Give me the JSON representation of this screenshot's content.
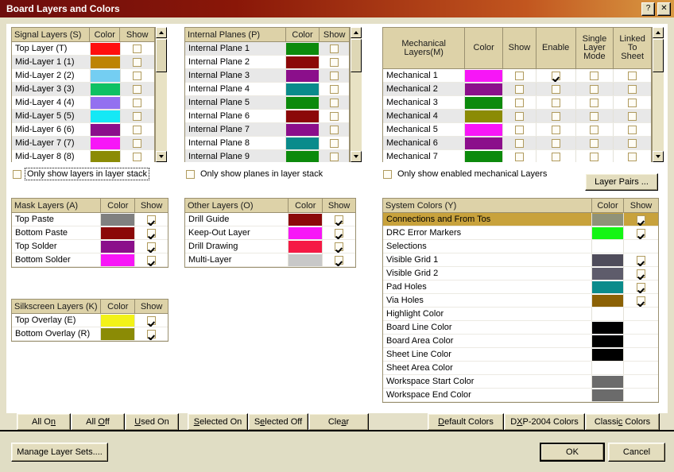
{
  "window": {
    "title": "Board Layers and Colors",
    "help_button": "?",
    "close_button": "✕"
  },
  "signal_layers": {
    "headers": [
      "Signal Layers (S)",
      "Color",
      "Show"
    ],
    "rows": [
      {
        "name": "Top Layer (T)",
        "color": "#ff0f0f",
        "show": false
      },
      {
        "name": "Mid-Layer 1 (1)",
        "color": "#bd8403",
        "show": false
      },
      {
        "name": "Mid-Layer 2 (2)",
        "color": "#74cef2",
        "show": false
      },
      {
        "name": "Mid-Layer 3 (3)",
        "color": "#0ec163",
        "show": false
      },
      {
        "name": "Mid-Layer 4 (4)",
        "color": "#9370f0",
        "show": false
      },
      {
        "name": "Mid-Layer 5 (5)",
        "color": "#15e8f5",
        "show": false
      },
      {
        "name": "Mid-Layer 6 (6)",
        "color": "#8b0f8b",
        "show": false
      },
      {
        "name": "Mid-Layer 7 (7)",
        "color": "#f716f7",
        "show": false
      },
      {
        "name": "Mid-Layer 8 (8)",
        "color": "#8b8b05",
        "show": false
      }
    ],
    "option": {
      "label": "Only show layers in layer stack",
      "checked": false,
      "focused": true
    }
  },
  "internal_planes": {
    "headers": [
      "Internal Planes (P)",
      "Color",
      "Show"
    ],
    "rows": [
      {
        "name": "Internal Plane 1",
        "color": "#0c8a0c",
        "show": false
      },
      {
        "name": "Internal Plane 2",
        "color": "#8b0808",
        "show": false
      },
      {
        "name": "Internal Plane 3",
        "color": "#8b0f8b",
        "show": false
      },
      {
        "name": "Internal Plane 4",
        "color": "#0a8b8b",
        "show": false
      },
      {
        "name": "Internal Plane 5",
        "color": "#0c8a0c",
        "show": false
      },
      {
        "name": "Internal Plane 6",
        "color": "#8b0808",
        "show": false
      },
      {
        "name": "Internal Plane 7",
        "color": "#8b0f8b",
        "show": false
      },
      {
        "name": "Internal Plane 8",
        "color": "#0a8b8b",
        "show": false
      },
      {
        "name": "Internal Plane 9",
        "color": "#0c8a0c",
        "show": false
      }
    ],
    "option": {
      "label": "Only show planes in layer stack",
      "checked": false,
      "focused": false
    }
  },
  "mechanical_layers": {
    "headers": [
      "Mechanical Layers(M)",
      "Color",
      "Show",
      "Enable",
      "Single Layer Mode",
      "Linked To Sheet"
    ],
    "rows": [
      {
        "name": "Mechanical 1",
        "color": "#f716f7",
        "show": false,
        "enable": true,
        "single_layer_mode": false,
        "linked_to_sheet": false
      },
      {
        "name": "Mechanical 2",
        "color": "#8b0f8b",
        "show": false,
        "enable": false,
        "single_layer_mode": false,
        "linked_to_sheet": false
      },
      {
        "name": "Mechanical 3",
        "color": "#0c8a0c",
        "show": false,
        "enable": false,
        "single_layer_mode": false,
        "linked_to_sheet": false
      },
      {
        "name": "Mechanical 4",
        "color": "#8b8b05",
        "show": false,
        "enable": false,
        "single_layer_mode": false,
        "linked_to_sheet": false
      },
      {
        "name": "Mechanical 5",
        "color": "#f716f7",
        "show": false,
        "enable": false,
        "single_layer_mode": false,
        "linked_to_sheet": false
      },
      {
        "name": "Mechanical 6",
        "color": "#8b0f8b",
        "show": false,
        "enable": false,
        "single_layer_mode": false,
        "linked_to_sheet": false
      },
      {
        "name": "Mechanical 7",
        "color": "#0c8a0c",
        "show": false,
        "enable": false,
        "single_layer_mode": false,
        "linked_to_sheet": false
      }
    ],
    "option": {
      "label": "Only show enabled mechanical Layers",
      "checked": false,
      "focused": false
    },
    "layer_pairs_button": "Layer Pairs ..."
  },
  "mask_layers": {
    "headers": [
      "Mask Layers (A)",
      "Color",
      "Show"
    ],
    "rows": [
      {
        "name": "Top Paste",
        "color": "#808080",
        "show": true
      },
      {
        "name": "Bottom Paste",
        "color": "#8b0808",
        "show": true
      },
      {
        "name": "Top Solder",
        "color": "#8b0f8b",
        "show": true
      },
      {
        "name": "Bottom Solder",
        "color": "#f716f7",
        "show": true
      }
    ]
  },
  "silkscreen_layers": {
    "headers": [
      "Silkscreen Layers (K)",
      "Color",
      "Show"
    ],
    "rows": [
      {
        "name": "Top Overlay (E)",
        "color": "#f2f218",
        "show": true
      },
      {
        "name": "Bottom Overlay (R)",
        "color": "#8b8b05",
        "show": true
      }
    ]
  },
  "other_layers": {
    "headers": [
      "Other Layers (O)",
      "Color",
      "Show"
    ],
    "rows": [
      {
        "name": "Drill Guide",
        "color": "#8b0808",
        "show": true
      },
      {
        "name": "Keep-Out Layer",
        "color": "#f716f7",
        "show": true
      },
      {
        "name": "Drill Drawing",
        "color": "#f51a45",
        "show": true
      },
      {
        "name": "Multi-Layer",
        "color": "#c8c8c8",
        "show": true
      }
    ]
  },
  "system_colors": {
    "headers": [
      "System Colors (Y)",
      "Color",
      "Show"
    ],
    "rows": [
      {
        "name": "Connections and From Tos",
        "color": "#8f9278",
        "show": true,
        "selected": true
      },
      {
        "name": "DRC Error Markers",
        "color": "#14f514",
        "show": true,
        "selected": false
      },
      {
        "name": "Selections",
        "color": "",
        "show": null,
        "selected": false
      },
      {
        "name": "Visible Grid 1",
        "color": "#4f4d5b",
        "show": true,
        "selected": false
      },
      {
        "name": "Visible Grid 2",
        "color": "#5e5c6b",
        "show": true,
        "selected": false
      },
      {
        "name": "Pad Holes",
        "color": "#0a8b8b",
        "show": true,
        "selected": false
      },
      {
        "name": "Via Holes",
        "color": "#8b6105",
        "show": true,
        "selected": false
      },
      {
        "name": "Highlight Color",
        "color": "",
        "show": null,
        "selected": false
      },
      {
        "name": "Board Line Color",
        "color": "#000000",
        "show": null,
        "selected": false
      },
      {
        "name": "Board Area Color",
        "color": "#000000",
        "show": null,
        "selected": false
      },
      {
        "name": "Sheet Line Color",
        "color": "#000000",
        "show": null,
        "selected": false
      },
      {
        "name": "Sheet Area Color",
        "color": "",
        "show": null,
        "selected": false
      },
      {
        "name": "Workspace Start Color",
        "color": "#6b6b6b",
        "show": null,
        "selected": false
      },
      {
        "name": "Workspace End Color",
        "color": "#6b6b6b",
        "show": null,
        "selected": false
      }
    ]
  },
  "actions": {
    "all_on": "All On",
    "all_off": "All Off",
    "used_on": "Used On",
    "selected_on": "Selected On",
    "selected_off": "Selected Off",
    "clear": "Clear",
    "default_colors": "Default Colors",
    "dxp_colors": "DXP-2004 Colors",
    "classic_colors": "Classic Colors"
  },
  "footer": {
    "manage_layer_sets": "Manage Layer Sets....",
    "ok": "OK",
    "cancel": "Cancel"
  }
}
